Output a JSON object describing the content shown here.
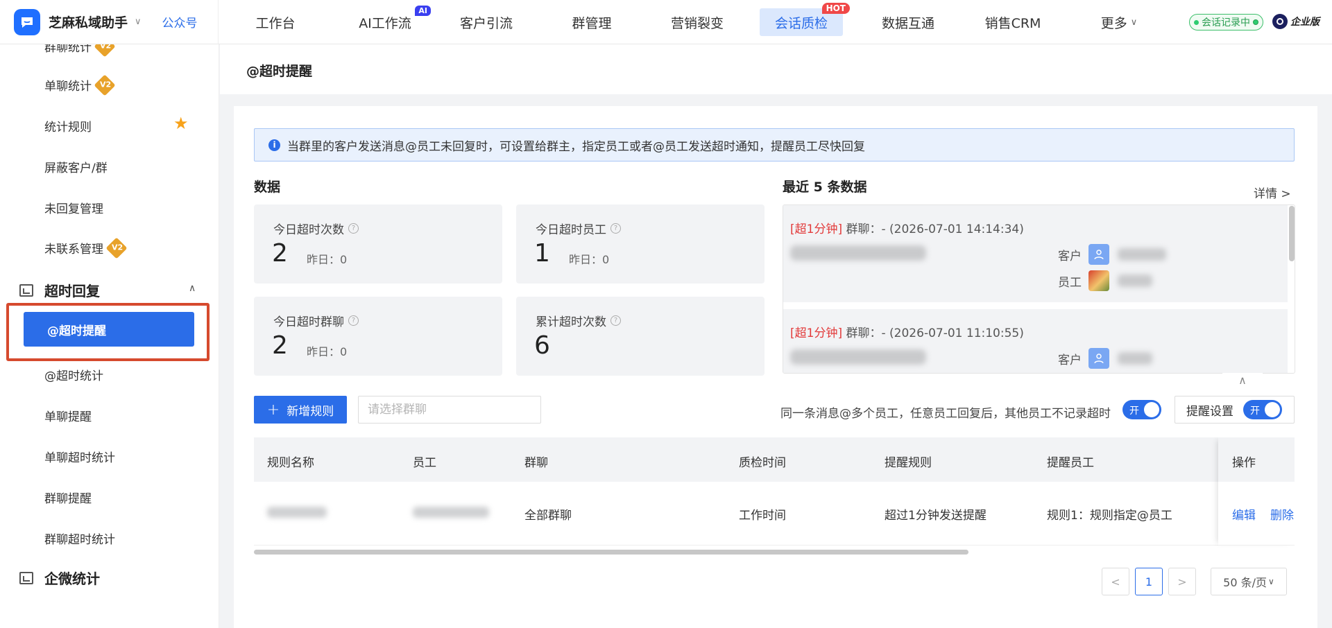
{
  "header": {
    "app_name": "芝麻私域助手",
    "gzh": "公众号",
    "nav": [
      {
        "label": "工作台",
        "badge": ""
      },
      {
        "label": "AI工作流",
        "badge": "AI"
      },
      {
        "label": "客户引流",
        "badge": ""
      },
      {
        "label": "群管理",
        "badge": ""
      },
      {
        "label": "营销裂变",
        "badge": ""
      },
      {
        "label": "会话质检",
        "badge": "HOT"
      },
      {
        "label": "数据互通",
        "badge": ""
      },
      {
        "label": "销售CRM",
        "badge": ""
      },
      {
        "label": "更多",
        "badge": ""
      }
    ],
    "recording": "会话记录中",
    "edition": "企业版"
  },
  "sidebar": {
    "items_top": [
      "群聊统计",
      "单聊统计",
      "统计规则",
      "屏蔽客户/群",
      "未回复管理",
      "未联系管理"
    ],
    "v2_badge": "V2",
    "group1": "超时回复",
    "group1_items": [
      "@超时提醒",
      "@超时统计",
      "单聊提醒",
      "单聊超时统计",
      "群聊提醒",
      "群聊超时统计"
    ],
    "group2": "企微统计"
  },
  "page": {
    "title": "@超时提醒",
    "notice": "当群里的客户发送消息@员工未回复时，可设置给群主，指定员工或者@员工发送超时通知，提醒员工尽快回复",
    "data_title": "数据",
    "stats": [
      {
        "label": "今日超时次数",
        "value": "2",
        "yesterday": "昨日：0"
      },
      {
        "label": "今日超时员工",
        "value": "1",
        "yesterday": "昨日：0"
      },
      {
        "label": "今日超时群聊",
        "value": "2",
        "yesterday": "昨日：0"
      },
      {
        "label": "累计超时次数",
        "value": "6",
        "yesterday": ""
      }
    ],
    "recent_title": "最近 5 条数据",
    "details": "详情",
    "recent": [
      {
        "tag": "[超1分钟]",
        "text": "群聊：-",
        "time": "(2026-07-01 14:14:34)",
        "customer": "客户",
        "staff": "员工"
      },
      {
        "tag": "[超1分钟]",
        "text": "群聊：-",
        "time": "(2026-07-01 11:10:55)",
        "customer": "客户",
        "staff": "员工"
      }
    ],
    "add_rule": "新增规则",
    "select_placeholder": "请选择群聊",
    "option_text": "同一条消息@多个员工，任意员工回复后，其他员工不记录超时",
    "toggle_on": "开",
    "remind_settings": "提醒设置",
    "table": {
      "headers": [
        "规则名称",
        "员工",
        "群聊",
        "质检时间",
        "提醒规则",
        "提醒员工",
        "操作"
      ],
      "rows": [
        {
          "group": "全部群聊",
          "time": "工作时间",
          "rule": "超过1分钟发送提醒",
          "remind": "规则1：规则指定@员工",
          "edit": "编辑",
          "delete": "删除"
        }
      ]
    },
    "pagination": {
      "prev": "<",
      "current": "1",
      "next": ">",
      "size": "50 条/页"
    }
  },
  "colors": {
    "primary": "#2b6de8",
    "highlight_border": "#d64a2e",
    "hot": "#f04848",
    "overtime_tag": "#e23b3b"
  }
}
